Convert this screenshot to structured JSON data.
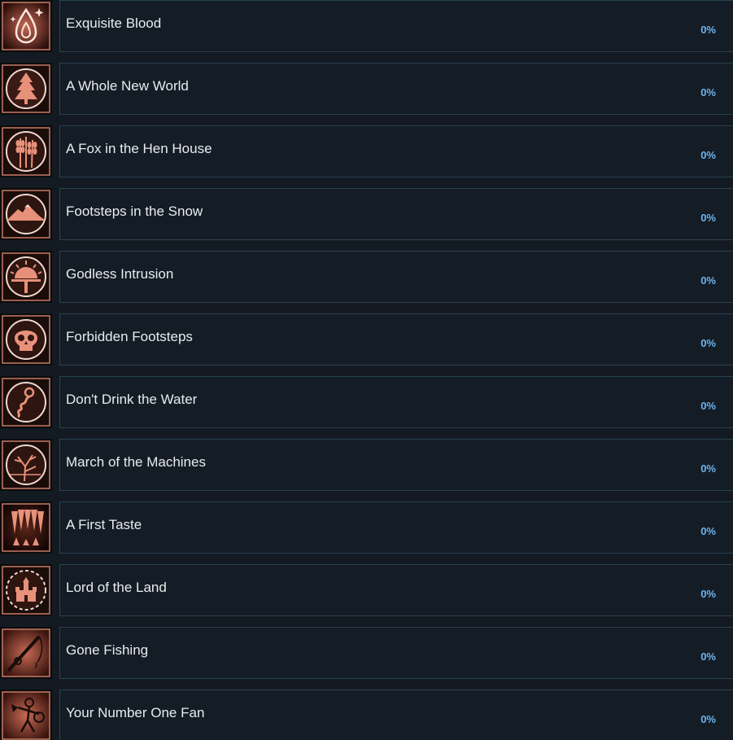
{
  "achievements": [
    {
      "name": "Exquisite Blood",
      "percent": "0%",
      "icon": "blood-drop-icon"
    },
    {
      "name": "A Whole New World",
      "percent": "0%",
      "icon": "pine-tree-icon"
    },
    {
      "name": "A Fox in the Hen House",
      "percent": "0%",
      "icon": "wheat-icon"
    },
    {
      "name": "Footsteps in the Snow",
      "percent": "0%",
      "icon": "mountain-icon"
    },
    {
      "name": "Godless Intrusion",
      "percent": "0%",
      "icon": "sun-altar-icon"
    },
    {
      "name": "Forbidden Footsteps",
      "percent": "0%",
      "icon": "skull-icon"
    },
    {
      "name": "Don't Drink the Water",
      "percent": "0%",
      "icon": "worm-icon"
    },
    {
      "name": "March of the Machines",
      "percent": "0%",
      "icon": "dead-tree-icon"
    },
    {
      "name": "A First Taste",
      "percent": "0%",
      "icon": "fangs-icon"
    },
    {
      "name": "Lord of the Land",
      "percent": "0%",
      "icon": "castle-icon"
    },
    {
      "name": "Gone Fishing",
      "percent": "0%",
      "icon": "fishing-rod-icon"
    },
    {
      "name": "Your Number One Fan",
      "percent": "0%",
      "icon": "warrior-icon"
    }
  ],
  "colors": {
    "background": "#131a22",
    "card": "#141c25",
    "card_border": "#2a4250",
    "text": "#e8ecef",
    "percent": "#6db4f0",
    "icon_accent": "#e8917a"
  }
}
